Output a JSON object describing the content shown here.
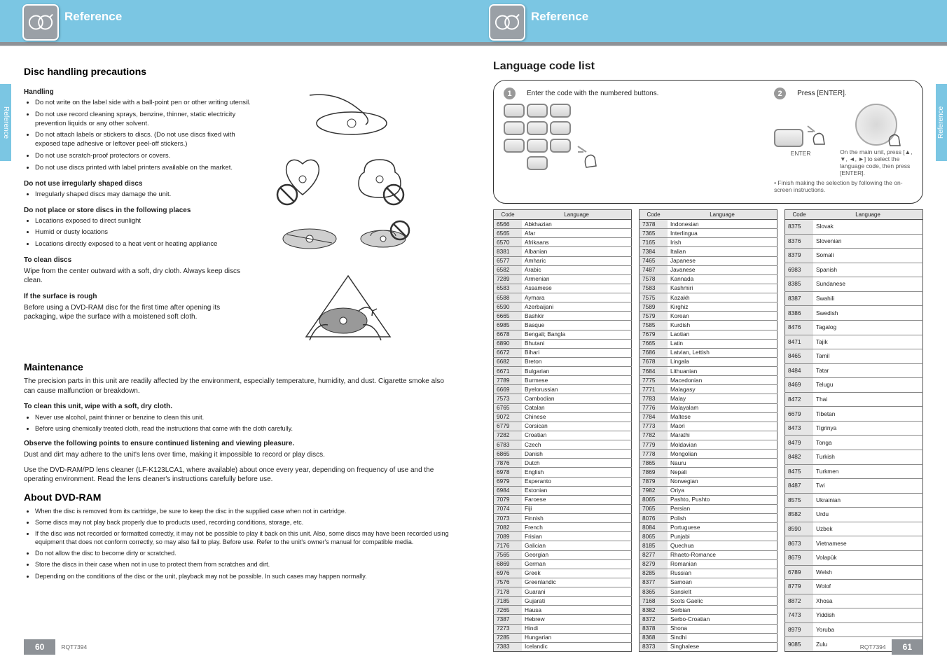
{
  "header": {
    "left_title": "Reference",
    "right_title": "Reference"
  },
  "side_tab": "Reference",
  "left_page": {
    "title": "Disc handling precautions",
    "handling_h": "Handling",
    "handling_bullets": [
      "Do not write on the label side with a ball-point pen or other writing utensil.",
      "Do not use record cleaning sprays, benzine, thinner, static electricity prevention liquids or any other solvent.",
      "Do not attach labels or stickers to discs. (Do not use discs fixed with exposed tape adhesive or leftover peel-off stickers.)",
      "Do not use scratch-proof protectors or covers.",
      "Do not use discs printed with label printers available on the market."
    ],
    "irregular_h": "Do not use irregularly shaped discs",
    "irregular_bullets": [
      "Irregularly shaped discs may damage the unit."
    ],
    "place_h": "Do not place or store discs in the following places",
    "place_bullets": [
      "Locations exposed to direct sunlight",
      "Humid or dusty locations",
      "Locations directly exposed to a heat vent or heating appliance"
    ],
    "clean_h": "To clean discs",
    "clean_text": "Wipe from the center outward with a soft, dry cloth. Always keep discs clean.",
    "rough_h": "If the surface is rough",
    "rough_text": "Before using a DVD-RAM disc for the first time after opening its packaging, wipe the surface with a moistened soft cloth.",
    "maint_h": "Maintenance",
    "maint_intro": "The precision parts in this unit are readily affected by the environment, especially temperature, humidity, and dust. Cigarette smoke also can cause malfunction or breakdown.",
    "maint_cloth_h": "To clean this unit, wipe with a soft, dry cloth.",
    "maint_cloth_bullets": [
      "Never use alcohol, paint thinner or benzine to clean this unit.",
      "Before using chemically treated cloth, read the instructions that came with the cloth carefully."
    ],
    "maint_obs_h": "Observe the following points to ensure continued listening and viewing pleasure.",
    "maint_obs_text": "Dust and dirt may adhere to the unit's lens over time, making it impossible to record or play discs.",
    "maint_clean_h": "Use the DVD-RAM/PD lens cleaner (LF-K123LCA1, where available) about once every year, depending on frequency of use and the operating environment. Read the lens cleaner's instructions carefully before use.",
    "about_h": "About DVD-RAM",
    "about_bullets": [
      "When the disc is removed from its cartridge, be sure to keep the disc in the supplied case when not in cartridge.",
      "Some discs may not play back properly due to products used, recording conditions, storage, etc.",
      "If the disc was not recorded or formatted correctly, it may not be possible to play it back on this unit. Also, some discs may have been recorded using equipment that does not conform correctly, so may also fail to play. Before use. Refer to the unit's owner's manual for compatible media.",
      "Do not allow the disc to become dirty or scratched.",
      "Store the discs in their case when not in use to protect them from scratches and dirt.",
      "Depending on the conditions of the disc or the unit, playback may not be possible. In such cases may happen normally."
    ]
  },
  "right_page": {
    "title": "Language code list",
    "step1_label": "Enter the code with the numbered buttons.",
    "step2_label": "Press [ENTER].",
    "step2_alt_intro": "On the main unit, press [▲, ▼, ◄, ►] to select the language code, then press [ENTER].",
    "note_below": "• Finish making the selection by following the on-screen instructions.",
    "col_headers": [
      "Code",
      "Language"
    ],
    "tables": [
      [
        [
          "6566",
          "Abkhazian"
        ],
        [
          "6565",
          "Afar"
        ],
        [
          "6570",
          "Afrikaans"
        ],
        [
          "8381",
          "Albanian"
        ],
        [
          "6577",
          "Amharic"
        ],
        [
          "6582",
          "Arabic"
        ],
        [
          "7289",
          "Armenian"
        ],
        [
          "6583",
          "Assamese"
        ],
        [
          "6588",
          "Aymara"
        ],
        [
          "6590",
          "Azerbaijani"
        ],
        [
          "6665",
          "Bashkir"
        ],
        [
          "6985",
          "Basque"
        ],
        [
          "6678",
          "Bengali; Bangla"
        ],
        [
          "6890",
          "Bhutani"
        ],
        [
          "6672",
          "Bihari"
        ],
        [
          "6682",
          "Breton"
        ],
        [
          "6671",
          "Bulgarian"
        ],
        [
          "7789",
          "Burmese"
        ],
        [
          "6669",
          "Byelorussian"
        ],
        [
          "7573",
          "Cambodian"
        ],
        [
          "6765",
          "Catalan"
        ],
        [
          "9072",
          "Chinese"
        ],
        [
          "6779",
          "Corsican"
        ],
        [
          "7282",
          "Croatian"
        ],
        [
          "6783",
          "Czech"
        ],
        [
          "6865",
          "Danish"
        ],
        [
          "7876",
          "Dutch"
        ],
        [
          "6978",
          "English"
        ],
        [
          "6979",
          "Esperanto"
        ],
        [
          "6984",
          "Estonian"
        ],
        [
          "7079",
          "Faroese"
        ],
        [
          "7074",
          "Fiji"
        ],
        [
          "7073",
          "Finnish"
        ],
        [
          "7082",
          "French"
        ],
        [
          "7089",
          "Frisian"
        ],
        [
          "7176",
          "Galician"
        ],
        [
          "7565",
          "Georgian"
        ],
        [
          "6869",
          "German"
        ],
        [
          "6976",
          "Greek"
        ],
        [
          "7576",
          "Greenlandic"
        ],
        [
          "7178",
          "Guarani"
        ],
        [
          "7185",
          "Gujarati"
        ],
        [
          "7265",
          "Hausa"
        ],
        [
          "7387",
          "Hebrew"
        ],
        [
          "7273",
          "Hindi"
        ],
        [
          "7285",
          "Hungarian"
        ],
        [
          "7383",
          "Icelandic"
        ]
      ],
      [
        [
          "7378",
          "Indonesian"
        ],
        [
          "7365",
          "Interlingua"
        ],
        [
          "7165",
          "Irish"
        ],
        [
          "7384",
          "Italian"
        ],
        [
          "7465",
          "Japanese"
        ],
        [
          "7487",
          "Javanese"
        ],
        [
          "7578",
          "Kannada"
        ],
        [
          "7583",
          "Kashmiri"
        ],
        [
          "7575",
          "Kazakh"
        ],
        [
          "7589",
          "Kirghiz"
        ],
        [
          "7579",
          "Korean"
        ],
        [
          "7585",
          "Kurdish"
        ],
        [
          "7679",
          "Laotian"
        ],
        [
          "7665",
          "Latin"
        ],
        [
          "7686",
          "Latvian, Lettish"
        ],
        [
          "7678",
          "Lingala"
        ],
        [
          "7684",
          "Lithuanian"
        ],
        [
          "7775",
          "Macedonian"
        ],
        [
          "7771",
          "Malagasy"
        ],
        [
          "7783",
          "Malay"
        ],
        [
          "7776",
          "Malayalam"
        ],
        [
          "7784",
          "Maltese"
        ],
        [
          "7773",
          "Maori"
        ],
        [
          "7782",
          "Marathi"
        ],
        [
          "7779",
          "Moldavian"
        ],
        [
          "7778",
          "Mongolian"
        ],
        [
          "7865",
          "Nauru"
        ],
        [
          "7869",
          "Nepali"
        ],
        [
          "7879",
          "Norwegian"
        ],
        [
          "7982",
          "Oriya"
        ],
        [
          "8065",
          "Pashto, Pushto"
        ],
        [
          "7065",
          "Persian"
        ],
        [
          "8076",
          "Polish"
        ],
        [
          "8084",
          "Portuguese"
        ],
        [
          "8065",
          "Punjabi"
        ],
        [
          "8185",
          "Quechua"
        ],
        [
          "8277",
          "Rhaeto-Romance"
        ],
        [
          "8279",
          "Romanian"
        ],
        [
          "8285",
          "Russian"
        ],
        [
          "8377",
          "Samoan"
        ],
        [
          "8365",
          "Sanskrit"
        ],
        [
          "7168",
          "Scots Gaelic"
        ],
        [
          "8382",
          "Serbian"
        ],
        [
          "8372",
          "Serbo-Croatian"
        ],
        [
          "8378",
          "Shona"
        ],
        [
          "8368",
          "Sindhi"
        ],
        [
          "8373",
          "Singhalese"
        ]
      ],
      [
        [
          "8375",
          "Slovak"
        ],
        [
          "8376",
          "Slovenian"
        ],
        [
          "8379",
          "Somali"
        ],
        [
          "6983",
          "Spanish"
        ],
        [
          "8385",
          "Sundanese"
        ],
        [
          "8387",
          "Swahili"
        ],
        [
          "8386",
          "Swedish"
        ],
        [
          "8476",
          "Tagalog"
        ],
        [
          "8471",
          "Tajik"
        ],
        [
          "8465",
          "Tamil"
        ],
        [
          "8484",
          "Tatar"
        ],
        [
          "8469",
          "Telugu"
        ],
        [
          "8472",
          "Thai"
        ],
        [
          "6679",
          "Tibetan"
        ],
        [
          "8473",
          "Tigrinya"
        ],
        [
          "8479",
          "Tonga"
        ],
        [
          "8482",
          "Turkish"
        ],
        [
          "8475",
          "Turkmen"
        ],
        [
          "8487",
          "Twi"
        ],
        [
          "8575",
          "Ukrainian"
        ],
        [
          "8582",
          "Urdu"
        ],
        [
          "8590",
          "Uzbek"
        ],
        [
          "8673",
          "Vietnamese"
        ],
        [
          "8679",
          "Volapük"
        ],
        [
          "6789",
          "Welsh"
        ],
        [
          "8779",
          "Wolof"
        ],
        [
          "8872",
          "Xhosa"
        ],
        [
          "7473",
          "Yiddish"
        ],
        [
          "8979",
          "Yoruba"
        ],
        [
          "9085",
          "Zulu"
        ]
      ]
    ],
    "step_numbers": [
      "1",
      "2"
    ],
    "enter_label": "ENTER"
  },
  "footer": {
    "left_num": "60",
    "right_num": "61",
    "ref_left": "RQT7394",
    "ref_right": "RQT7394"
  }
}
